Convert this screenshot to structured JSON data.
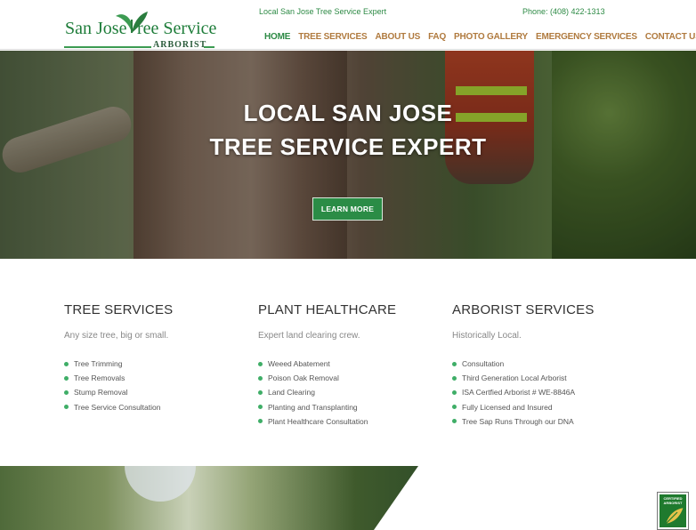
{
  "header": {
    "logo": {
      "word1": "San Jose",
      "word2": "ree Service",
      "word3": "ARBORIST"
    },
    "tagline": "Local San Jose Tree Service Expert",
    "phone": "Phone: (408) 422-1313",
    "nav": [
      {
        "label": "HOME",
        "active": true
      },
      {
        "label": "TREE SERVICES"
      },
      {
        "label": "ABOUT US"
      },
      {
        "label": "FAQ"
      },
      {
        "label": "PHOTO GALLERY"
      },
      {
        "label": "EMERGENCY SERVICES"
      },
      {
        "label": "CONTACT US"
      }
    ]
  },
  "hero": {
    "line1": "LOCAL SAN JOSE",
    "line2": "TREE SERVICE EXPERT",
    "button": "LEARN MORE"
  },
  "columns": [
    {
      "title": "TREE SERVICES",
      "subtitle": "Any size tree, big or small.",
      "items": [
        "Tree Trimming",
        "Tree Removals",
        "Stump Removal",
        "Tree Service Consultation"
      ]
    },
    {
      "title": "PLANT HEALTHCARE",
      "subtitle": "Expert land clearing crew.",
      "items": [
        "Weeed Abatement",
        "Poison Oak Removal",
        "Land Clearing",
        "Planting and Transplanting",
        "Plant Healthcare Consultation"
      ]
    },
    {
      "title": "ARBORIST SERVICES",
      "subtitle": "Historically Local.",
      "items": [
        "Consultation",
        "Third Generation Local Arborist",
        "ISA Certfied Arborist # WE-8846A",
        "Fully Licensed and Insured",
        "Tree Sap Runs Through our DNA"
      ]
    }
  ],
  "badge": {
    "text": "CERTIFIED ARBORIST"
  },
  "colors": {
    "brand_green": "#2d8a45",
    "nav_brown": "#b07a3e",
    "bullet_green": "#3fae67"
  }
}
